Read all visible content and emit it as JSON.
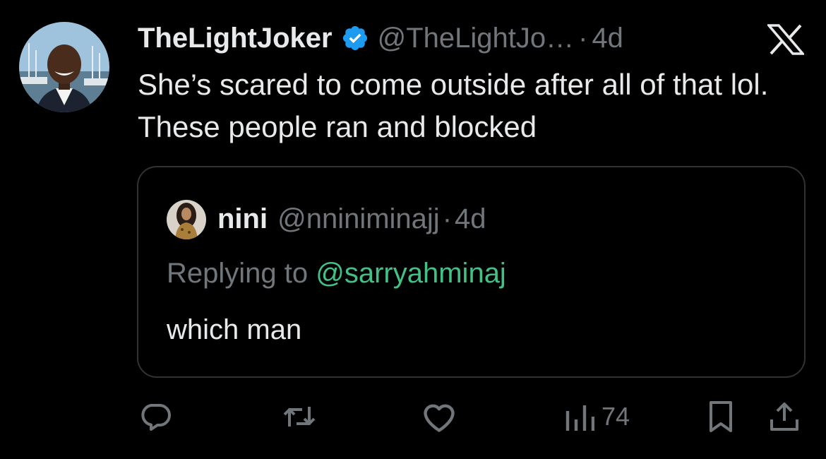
{
  "tweet": {
    "display_name": "TheLightJoker",
    "handle": "@TheLightJo…",
    "separator": "·",
    "time": "4d",
    "verified": true,
    "text": "She’s scared to come outside after all of that lol. These people ran and blocked"
  },
  "quoted_tweet": {
    "display_name": "nini",
    "handle": "@nniniminajj",
    "separator": "·",
    "time": "4d",
    "replying_prefix": "Replying to",
    "replying_mention": "@sarryahminaj",
    "text": "which man"
  },
  "actions": {
    "reply_icon": "reply-icon",
    "retweet_icon": "retweet-icon",
    "like_icon": "heart-icon",
    "views_icon": "views-icon",
    "views_count": "74",
    "bookmark_icon": "bookmark-icon",
    "share_icon": "share-icon"
  },
  "brand": {
    "logo": "x-logo-icon"
  },
  "colors": {
    "background": "#000000",
    "text_primary": "#e7e9ea",
    "text_secondary": "#71767b",
    "verified_blue": "#1d9bf0",
    "mention_green": "#43c085",
    "border": "#2f3336"
  }
}
